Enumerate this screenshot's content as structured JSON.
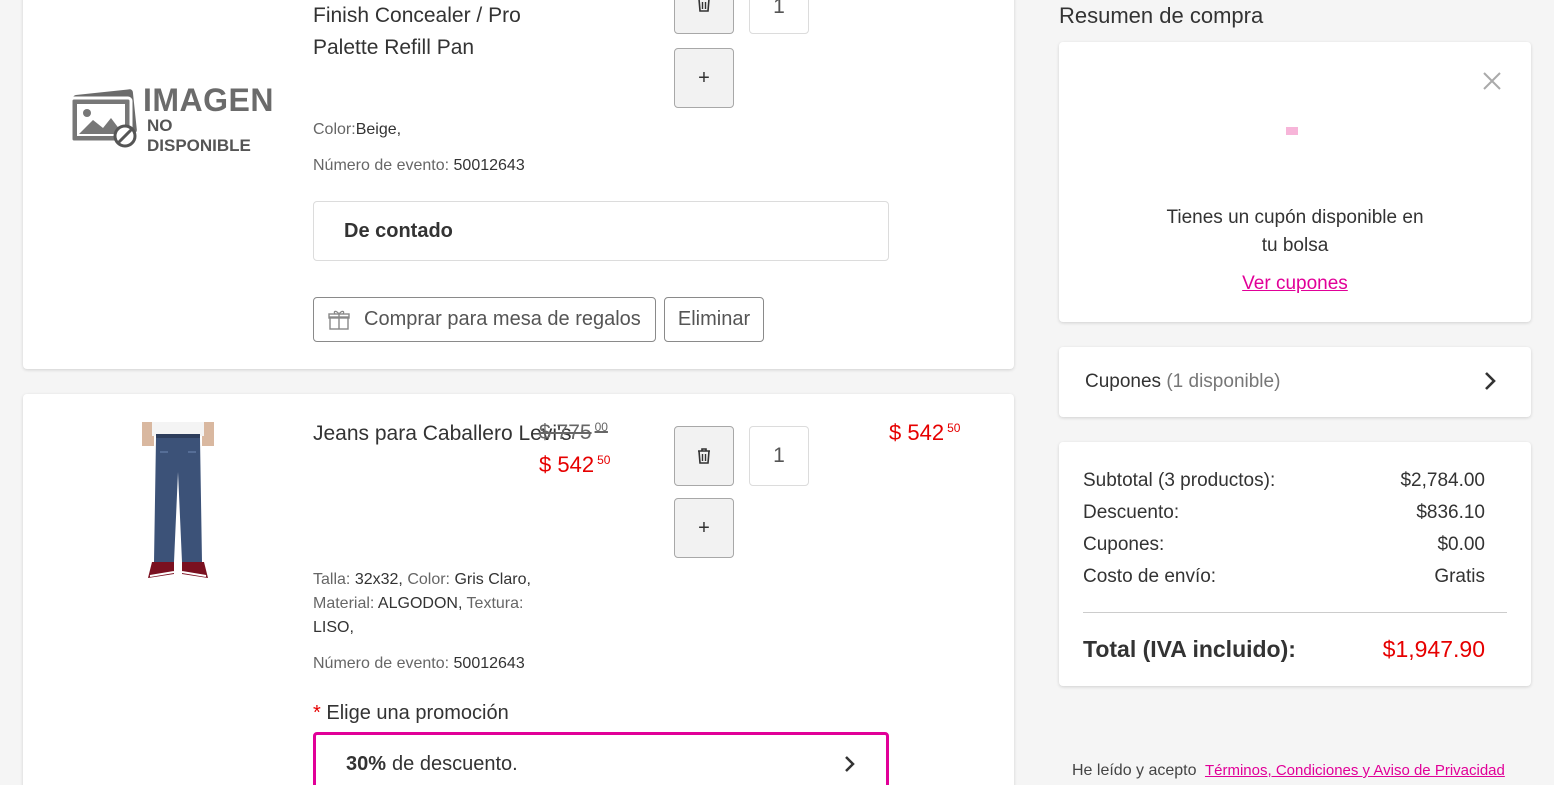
{
  "product1": {
    "title_line1": "Finish Concealer / Pro",
    "title_line2": "Palette Refill Pan",
    "image_line1": "IMAGEN",
    "image_line2": "NO DISPONIBLE",
    "qty": "1",
    "color_label": "Color:",
    "color_value": "Beige,",
    "event_label": "Número de evento:",
    "event_value": "50012643",
    "payment": "De contado",
    "gift_button": "Comprar para mesa de regalos",
    "remove_button": "Eliminar"
  },
  "product2": {
    "title": "Jeans para Caballero Levi's",
    "old_price": "$ 775",
    "old_price_cents": "00",
    "price": "$ 542",
    "price_cents": "50",
    "total_price": "$ 542",
    "total_price_cents": "50",
    "qty": "1",
    "attr_talla_label": "Talla:",
    "attr_talla_value": "32x32,",
    "attr_color_label": "Color:",
    "attr_color_value": "Gris Claro,",
    "attr_material_label": "Material:",
    "attr_material_value": "ALGODON,",
    "attr_textura_label": "Textura:",
    "attr_textura_value": "LISO,",
    "event_label": "Número de evento:",
    "event_value": "50012643",
    "promo_required": "*",
    "promo_label": "Elige una promoción",
    "promo_bold": "30%",
    "promo_text": "de descuento."
  },
  "summary": {
    "title": "Resumen de compra",
    "coupon_message_line1": "Tienes un cupón disponible en",
    "coupon_message_line2": "tu bolsa",
    "coupon_link": "Ver cupones",
    "coupons_label": "Cupones",
    "coupons_available": "(1 disponible)",
    "rows": [
      {
        "label": "Subtotal (3 productos):",
        "value": "$2,784.00"
      },
      {
        "label": "Descuento:",
        "value": "$836.10"
      },
      {
        "label": "Cupones:",
        "value": "$0.00"
      },
      {
        "label": "Costo de envío:",
        "value": "Gratis"
      }
    ],
    "total_label": "Total (IVA incluido):",
    "total_value": "$1,947.90",
    "terms_prefix": "He leído y acepto",
    "terms_link": "Términos, Condiciones y Aviso de Privacidad"
  },
  "colors": {
    "accent": "#e10098",
    "price": "#e60000"
  },
  "icons": [
    "trash-icon",
    "plus-icon",
    "gift-icon",
    "close-icon",
    "chevron-right-icon",
    "coupon-icon",
    "image-placeholder-icon"
  ]
}
